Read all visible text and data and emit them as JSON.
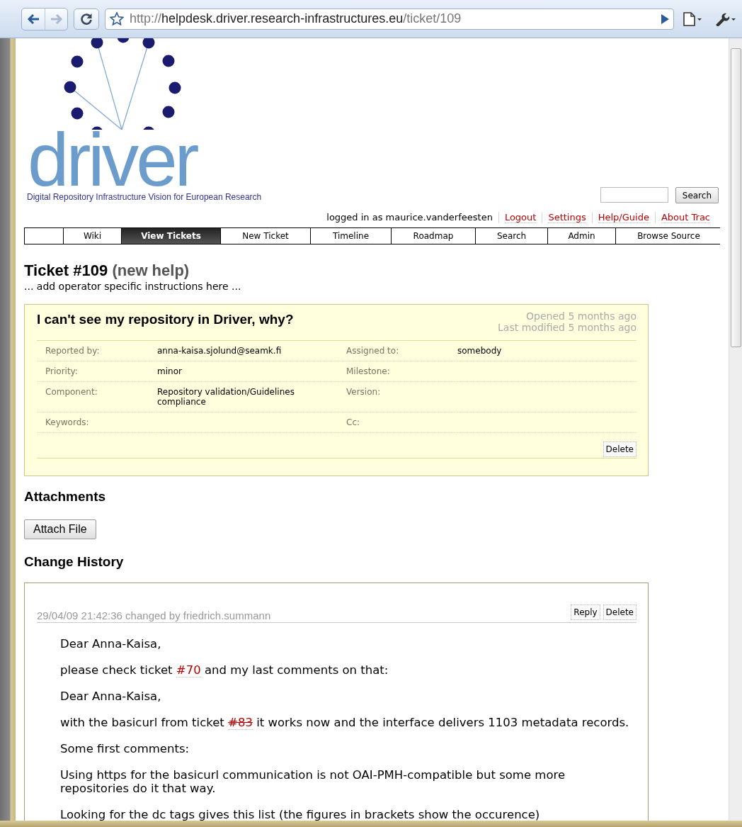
{
  "browser": {
    "back": {
      "disabled": false
    },
    "forward": {
      "disabled": true
    },
    "url": {
      "scheme": "http://",
      "host": "helpdesk.driver.research-infrastructures.eu",
      "path": "/ticket/109"
    }
  },
  "header": {
    "wordmark": "driver",
    "tagline": "Digital Repository Infrastructure Vision for European Research",
    "search_button": "Search"
  },
  "metanav": [
    {
      "kind": "text",
      "label": "logged in as maurice.vanderfeesten"
    },
    {
      "kind": "link",
      "label": "Logout"
    },
    {
      "kind": "link",
      "label": "Settings"
    },
    {
      "kind": "link",
      "label": "Help/Guide"
    },
    {
      "kind": "link",
      "label": "About Trac"
    }
  ],
  "mainnav": [
    {
      "label": "Wiki",
      "selected": false
    },
    {
      "label": "View Tickets",
      "selected": true
    },
    {
      "label": "New Ticket",
      "selected": false
    },
    {
      "label": "Timeline",
      "selected": false
    },
    {
      "label": "Roadmap",
      "selected": false
    },
    {
      "label": "Search",
      "selected": false
    },
    {
      "label": "Admin",
      "selected": false
    },
    {
      "label": "Browse Source",
      "selected": false
    }
  ],
  "ticket": {
    "title": "Ticket #109",
    "status": "(new help)",
    "instructions": "... add operator specific instructions here ...",
    "summary": "I can't see my repository in Driver, why?",
    "opened": "Opened 5 months ago",
    "modified": "Last modified 5 months ago",
    "properties": [
      {
        "label": "Reported by:",
        "value": "anna-kaisa.sjolund@seamk.fi",
        "label2": "Assigned to:",
        "value2": "somebody"
      },
      {
        "label": "Priority:",
        "value": "minor",
        "label2": "Milestone:"
      },
      {
        "label": "Component:",
        "value": "Repository validation/Guidelines compliance",
        "label2": "Version:"
      },
      {
        "label": "Keywords:",
        "label2": "Cc:"
      }
    ],
    "delete_button": "Delete"
  },
  "attachments": {
    "heading": "Attachments",
    "button": "Attach File"
  },
  "history": {
    "heading": "Change History",
    "changes": [
      {
        "header": "29/04/09 21:42:36 changed by friedrich.summann",
        "reply_button": "Reply",
        "delete_button": "Delete",
        "paragraphs": [
          [
            {
              "kind": "text",
              "text": "Dear Anna-Kaisa,"
            }
          ],
          [
            {
              "kind": "text",
              "text": "please check ticket "
            },
            {
              "kind": "link",
              "text": "#70",
              "closed": false
            },
            {
              "kind": "text",
              "text": " and my last comments on that:"
            }
          ],
          [
            {
              "kind": "text",
              "text": "Dear Anna-Kaisa,"
            }
          ],
          [
            {
              "kind": "text",
              "text": "with the basicurl from ticket "
            },
            {
              "kind": "link",
              "text": "#83",
              "closed": true
            },
            {
              "kind": "text",
              "text": " it works now and the interface delivers 1103 metadata records."
            }
          ],
          [
            {
              "kind": "text",
              "text": "Some first comments:"
            }
          ],
          [
            {
              "kind": "text",
              "text": "Using https for the basicurl communication is not OAI-PMH-compatible but some more repositories do it that way."
            }
          ],
          [
            {
              "kind": "text",
              "text": "Looking for the dc tags gives this list (the figures in brackets show the occurence)"
            }
          ]
        ]
      }
    ]
  }
}
